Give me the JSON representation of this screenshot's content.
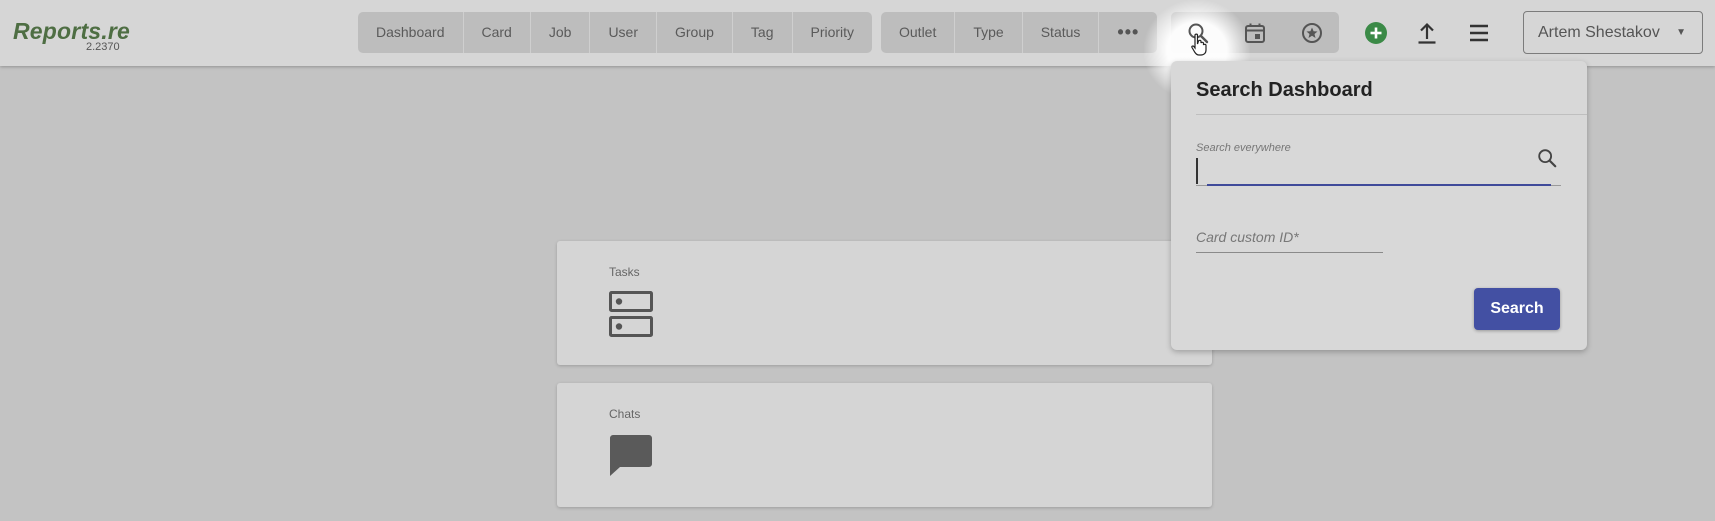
{
  "app": {
    "name": "Reports.re",
    "version": "2.2370"
  },
  "nav_primary": [
    {
      "label": "Dashboard"
    },
    {
      "label": "Card"
    },
    {
      "label": "Job"
    },
    {
      "label": "User"
    },
    {
      "label": "Group"
    },
    {
      "label": "Tag"
    },
    {
      "label": "Priority"
    }
  ],
  "nav_secondary": [
    {
      "label": "Outlet"
    },
    {
      "label": "Type"
    },
    {
      "label": "Status"
    },
    {
      "label": "•••"
    }
  ],
  "toolbar_icons": [
    "search-icon",
    "calendar-icon",
    "star-badge-icon",
    "add-circle-icon",
    "upload-icon",
    "menu-icon"
  ],
  "user": {
    "name": "Artem Shestakov",
    "caret": "▼"
  },
  "cards": [
    {
      "label": "Tasks",
      "icon": "storage-icon"
    },
    {
      "label": "Chats",
      "icon": "chat-icon"
    }
  ],
  "search_popup": {
    "title": "Search Dashboard",
    "search_label": "Search everywhere",
    "search_value": "",
    "card_id_placeholder": "Card custom ID*",
    "button_label": "Search"
  },
  "colors": {
    "brand_green": "#4e6e43",
    "accent_blue": "#4350a3",
    "add_green": "#3b8a47",
    "background": "#c3c3c3"
  }
}
